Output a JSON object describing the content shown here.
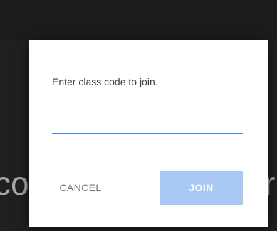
{
  "background": {
    "fragment_left": "co",
    "fragment_right": "r"
  },
  "dialog": {
    "prompt": "Enter class code to join.",
    "code_input": {
      "value": "",
      "placeholder": ""
    },
    "cancel_label": "CANCEL",
    "join_label": "JOIN",
    "join_enabled": false
  },
  "colors": {
    "accent": "#4285f4",
    "join_disabled": "#a9c9f5",
    "cancel_text": "#757575",
    "backdrop": "#1f2021"
  }
}
